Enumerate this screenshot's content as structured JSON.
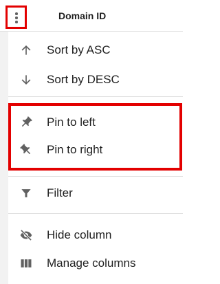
{
  "column_header": {
    "title": "Domain ID",
    "menu_icon": "more-vert-icon"
  },
  "column_menu": {
    "sort_asc": {
      "label": "Sort by ASC",
      "icon": "arrow-upward-icon"
    },
    "sort_desc": {
      "label": "Sort by DESC",
      "icon": "arrow-downward-icon"
    },
    "pin_left": {
      "label": "Pin to left",
      "icon": "push-pin-icon"
    },
    "pin_right": {
      "label": "Pin to right",
      "icon": "push-pin-icon"
    },
    "filter": {
      "label": "Filter",
      "icon": "filter-icon"
    },
    "hide_column": {
      "label": "Hide column",
      "icon": "visibility-off-icon"
    },
    "manage_columns": {
      "label": "Manage columns",
      "icon": "view-column-icon"
    }
  },
  "colors": {
    "highlight": "#e30000",
    "icon": "#616161",
    "text": "#212121",
    "divider": "#e0e0e0"
  }
}
